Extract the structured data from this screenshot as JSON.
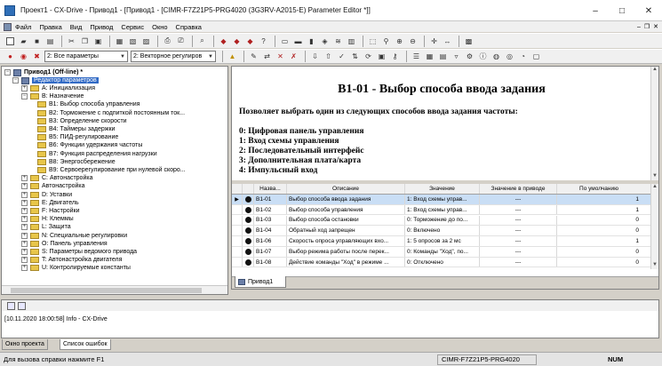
{
  "window": {
    "title": "Проект1 - CX-Drive - Привод1 - [Привод1 - [CIMR-F7Z21P5-PRG4020 (3G3RV-A2015-E)  Parameter Editor *]]",
    "controls": [
      "–",
      "□",
      "✕"
    ]
  },
  "menu": {
    "items": [
      "Файл",
      "Правка",
      "Вид",
      "Привод",
      "Сервис",
      "Окно",
      "Справка"
    ],
    "mdi_controls": [
      "–",
      "❐",
      "✕"
    ]
  },
  "toolbar2": {
    "filter_value": "2: Все параметры",
    "mode_value": "2: Векторное регулиров"
  },
  "tree": {
    "root": "Привод1 (Off-line) *",
    "editor": "Редактор параметров",
    "items": [
      {
        "label": "A: Инициализация",
        "level": 2,
        "kind": "closed",
        "exp": "+"
      },
      {
        "label": "B: Назначение",
        "level": 2,
        "kind": "open",
        "exp": "−"
      },
      {
        "label": "B1: Выбор способа управления",
        "level": 3,
        "kind": "folder",
        "exp": ""
      },
      {
        "label": "B2: Торможение с подпиткой постоянным ток...",
        "level": 3,
        "kind": "folder",
        "exp": ""
      },
      {
        "label": "B3: Определение скорости",
        "level": 3,
        "kind": "folder",
        "exp": ""
      },
      {
        "label": "B4: Таймеры задержки",
        "level": 3,
        "kind": "folder",
        "exp": ""
      },
      {
        "label": "B5: ПИД-регулирование",
        "level": 3,
        "kind": "folder",
        "exp": ""
      },
      {
        "label": "B6: Функции удержания частоты",
        "level": 3,
        "kind": "folder",
        "exp": ""
      },
      {
        "label": "B7: Функция распределения нагрузки",
        "level": 3,
        "kind": "folder",
        "exp": ""
      },
      {
        "label": "B8: Энергосбережение",
        "level": 3,
        "kind": "folder",
        "exp": ""
      },
      {
        "label": "B9: Сервоерегулирование при нулевой скоро...",
        "level": 3,
        "kind": "folder",
        "exp": ""
      },
      {
        "label": "C: Автонастройка",
        "level": 2,
        "kind": "closed",
        "exp": "+"
      },
      {
        "label": "Автонастройка",
        "level": 2,
        "kind": "closed",
        "exp": "+"
      },
      {
        "label": "D: Уставки",
        "level": 2,
        "kind": "closed",
        "exp": "+"
      },
      {
        "label": "E: Двигатель",
        "level": 2,
        "kind": "closed",
        "exp": "+"
      },
      {
        "label": "F: Настройки",
        "level": 2,
        "kind": "closed",
        "exp": "+"
      },
      {
        "label": "H: Клеммы",
        "level": 2,
        "kind": "closed",
        "exp": "+"
      },
      {
        "label": "L: Защита",
        "level": 2,
        "kind": "closed",
        "exp": "+"
      },
      {
        "label": "N: Специальные регулировки",
        "level": 2,
        "kind": "closed",
        "exp": "+"
      },
      {
        "label": "O: Панель управления",
        "level": 2,
        "kind": "closed",
        "exp": "+"
      },
      {
        "label": "S: Параметры ведомого привода",
        "level": 2,
        "kind": "closed",
        "exp": "+"
      },
      {
        "label": "T: Автонастройка двигателя",
        "level": 2,
        "kind": "closed",
        "exp": "+"
      },
      {
        "label": "U: Контролируемые константы",
        "level": 2,
        "kind": "closed",
        "exp": "+"
      }
    ]
  },
  "help": {
    "title": "B1-01 - Выбор способа ввода задания",
    "description": "Позволяет выбрать один из следующих способов ввода задания частоты:",
    "options": [
      "0: Цифровая панель управления",
      "1: Вход схемы управления",
      "2: Последовательный интерфейс",
      "3: Дополнительная плата/карта",
      "4: Импульсный вход"
    ]
  },
  "table": {
    "headers": [
      "Назва...",
      "Описание",
      "Значение",
      "Значение в приводе",
      "По умолчанию"
    ],
    "rows": [
      {
        "num": "B1-01",
        "desc": "Выбор способа ввода задания",
        "value": "1: Вход схемы управ...",
        "drive": "---",
        "default": "1",
        "active": true
      },
      {
        "num": "B1-02",
        "desc": "Выбор способа управления",
        "value": "1: Вход схемы управ...",
        "drive": "---",
        "default": "1",
        "active": false
      },
      {
        "num": "B1-03",
        "desc": "Выбор способа остановки",
        "value": "0: Торможение до по...",
        "drive": "---",
        "default": "0",
        "active": false
      },
      {
        "num": "B1-04",
        "desc": "Обратный ход запрещен",
        "value": "0: Включено",
        "drive": "---",
        "default": "0",
        "active": false
      },
      {
        "num": "B1-06",
        "desc": "Скорость опроса управляющих вхо...",
        "value": "1: 5 опросов за 2 мс",
        "drive": "---",
        "default": "1",
        "active": false
      },
      {
        "num": "B1-07",
        "desc": "Выбор режима работы после перек...",
        "value": "0: Команды \"Ход\", по...",
        "drive": "---",
        "default": "0",
        "active": false
      },
      {
        "num": "B1-08",
        "desc": "Действие команды \"Ход\" в режиме ...",
        "value": "0: Отключено",
        "drive": "---",
        "default": "0",
        "active": false
      }
    ]
  },
  "document_tab": "Привод1",
  "output": {
    "line": "[10.11.2020 18:00:58] Info  - CX-Drive"
  },
  "bottom_tabs": [
    "Окно проекта",
    "Список ошибок"
  ],
  "status": {
    "help": "Для вызова справки нажмите F1",
    "model": "CIMR-F7Z21P5-PRG4020",
    "num": "NUM"
  }
}
